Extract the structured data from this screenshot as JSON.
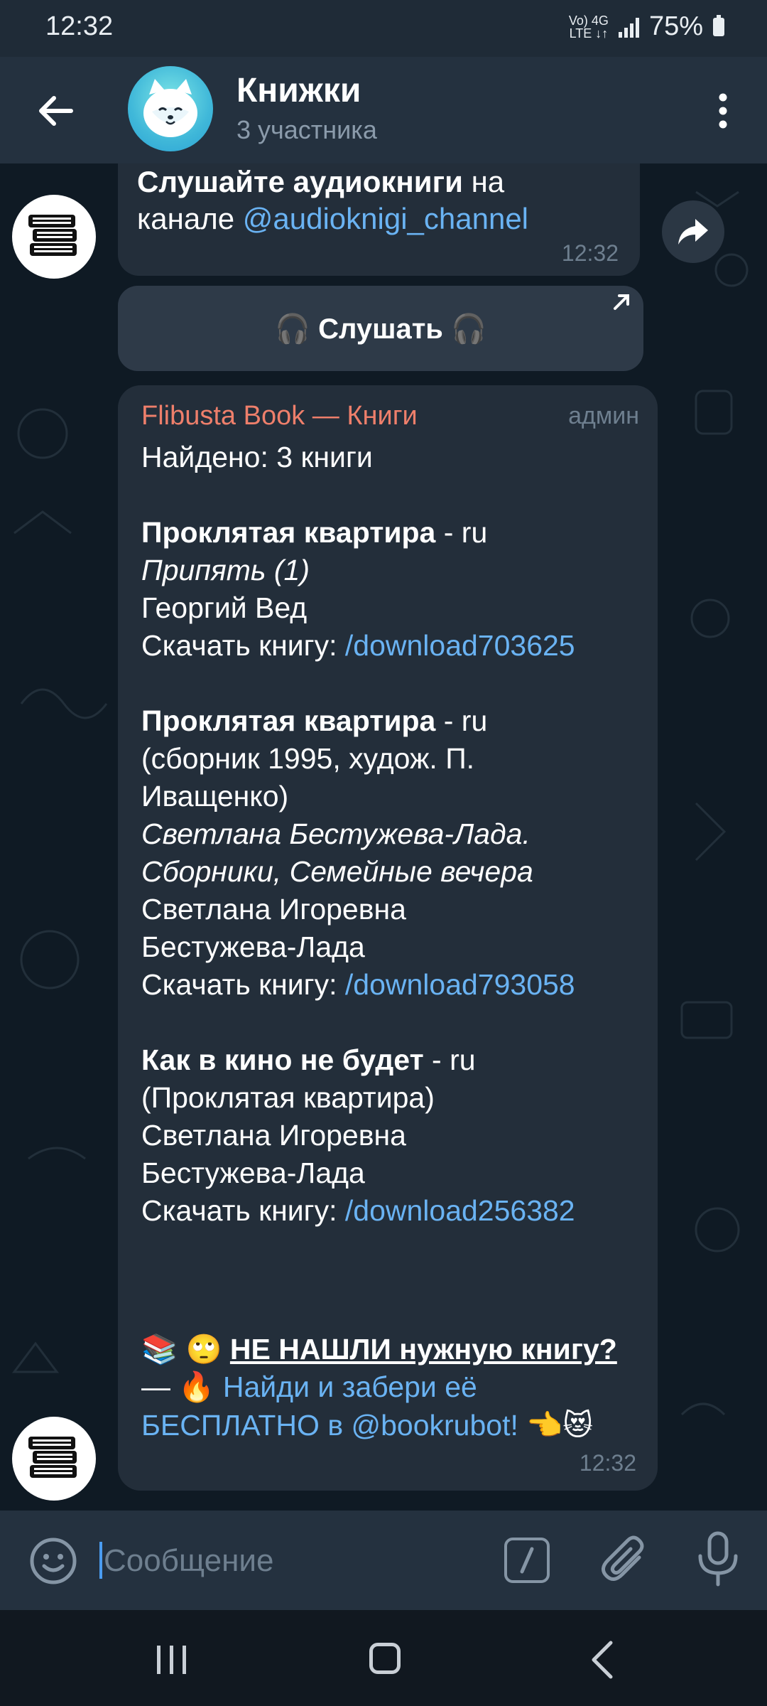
{
  "status_bar": {
    "time": "12:32",
    "network_top": "Vo) 4G",
    "network_bottom": "LTE ↓↑",
    "battery": "75%"
  },
  "header": {
    "title": "Книжки",
    "subtitle": "3 участника"
  },
  "messages": {
    "m1": {
      "line1_bold": "Слушайте аудиокниги",
      "line1_rest": " на",
      "line2_text": "канале ",
      "line2_link": "@audioknigi_channel",
      "time": "12:32"
    },
    "listen_button": {
      "label": "🎧 Слушать 🎧"
    },
    "m2": {
      "sender": "Flibusta Book — Книги",
      "role": "админ",
      "found": "Найдено: 3 книги",
      "book1": {
        "title": "Проклятая квартира",
        "lang": " - ru",
        "series": "Припять (1)",
        "author": "Георгий  Вед",
        "download_label": "Скачать книгу: ",
        "download_cmd": "/download703625"
      },
      "book2": {
        "title": "Проклятая квартира",
        "lang": " - ru",
        "note1": "(сборник 1995, худож. П.",
        "note2": "Иващенко)",
        "series1": "Светлана Бестужева-Лада.",
        "series2": "Сборники, Семейные вечера",
        "author1": "Светлана Игоревна",
        "author2": "Бестужева-Лада",
        "download_label": "Скачать книгу: ",
        "download_cmd": "/download793058"
      },
      "book3": {
        "title": "Как в кино не будет",
        "lang": " - ru",
        "note": "(Проклятая квартира)",
        "author1": "Светлана Игоревна",
        "author2": "Бестужева-Лада",
        "download_label": "Скачать книгу: ",
        "download_cmd": "/download256382"
      },
      "promo": {
        "emoji1": "📚 🙄 ",
        "headline": "НЕ НАШЛИ нужную книгу?",
        "line2_dash": "—  🔥 ",
        "line2_link": "Найди и забери её",
        "line3_link": "БЕСПЛАТНО в @bookrubot!",
        "line3_emoji": " 👈😻"
      },
      "time": "12:32"
    }
  },
  "input": {
    "placeholder": "Сообщение"
  },
  "colors": {
    "link": "#6ab3f3",
    "sender": "#ee7f6b",
    "bubble": "#232e3a",
    "header": "#24313f"
  }
}
